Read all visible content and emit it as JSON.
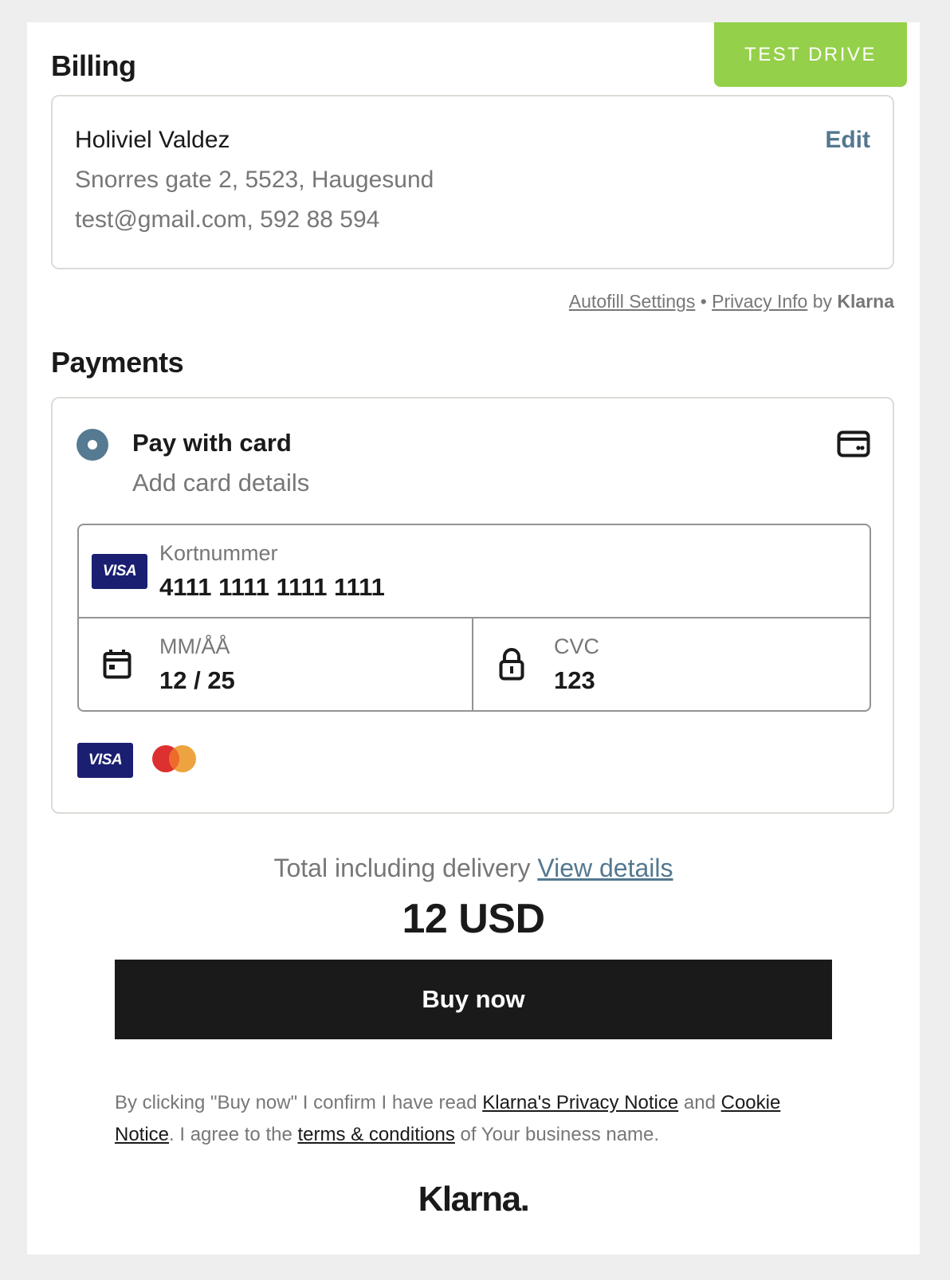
{
  "test_drive": {
    "label": "TEST DRIVE",
    "color": "#95d04a"
  },
  "billing": {
    "title": "Billing",
    "name": "Holiviel Valdez",
    "address": "Snorres gate 2, 5523, Haugesund",
    "contact": "test@gmail.com, 592 88 594",
    "edit_label": "Edit",
    "autofill_label": "Autofill Settings",
    "separator": "•",
    "privacy_label": "Privacy Info",
    "by_label": "by",
    "brand": "Klarna"
  },
  "payments": {
    "title": "Payments",
    "method_title": "Pay with card",
    "method_subtitle": "Add card details",
    "method_selected": true,
    "card_number_label": "Kortnummer",
    "card_number_value": "4111 1111 1111 1111",
    "expiry_label": "MM/ÅÅ",
    "expiry_value": "12 / 25",
    "cvc_label": "CVC",
    "cvc_value": "123",
    "card_brand": "VISA",
    "accepted_brands": [
      "VISA",
      "Mastercard"
    ],
    "accent_color": "#557a91"
  },
  "summary": {
    "total_label": "Total including delivery",
    "view_details_label": "View details",
    "amount": "12 USD",
    "buy_label": "Buy now"
  },
  "legal": {
    "part1": "By clicking \"Buy now\" I confirm I have read ",
    "privacy_link": "Klarna's Privacy Notice",
    "part2": " and ",
    "cookie_link": "Cookie Notice",
    "part3": ". I agree to the ",
    "terms_link": "terms & conditions",
    "part4": " of Your business name."
  },
  "footer": {
    "logo": "Klarna."
  }
}
